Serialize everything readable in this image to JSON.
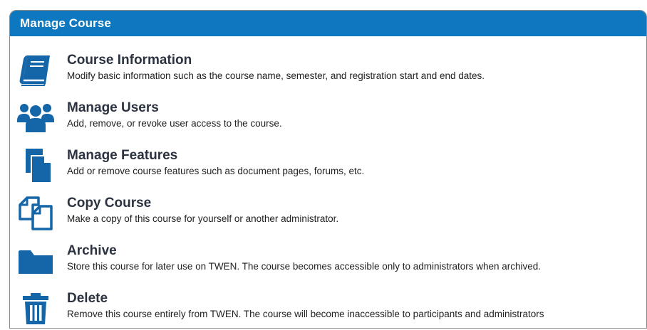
{
  "header": {
    "title": "Manage Course"
  },
  "colors": {
    "header_bg": "#0d78bf",
    "icon": "#1566a8",
    "title_text": "#2c3340"
  },
  "items": [
    {
      "icon": "book-icon",
      "title": "Course Information",
      "description": "Modify basic information such as the course name, semester, and registration start and end dates."
    },
    {
      "icon": "users-icon",
      "title": "Manage Users",
      "description": "Add, remove, or revoke user access to the course."
    },
    {
      "icon": "documents-icon",
      "title": "Manage Features",
      "description": "Add or remove course features such as document pages, forums, etc."
    },
    {
      "icon": "copy-icon",
      "title": "Copy Course",
      "description": "Make a copy of this course for yourself or another administrator."
    },
    {
      "icon": "folder-icon",
      "title": "Archive",
      "description": "Store this course for later use on TWEN. The course becomes accessible only to administrators when archived."
    },
    {
      "icon": "trash-icon",
      "title": "Delete",
      "description": "Remove this course entirely from TWEN. The course will become inaccessible to participants and administrators"
    }
  ]
}
